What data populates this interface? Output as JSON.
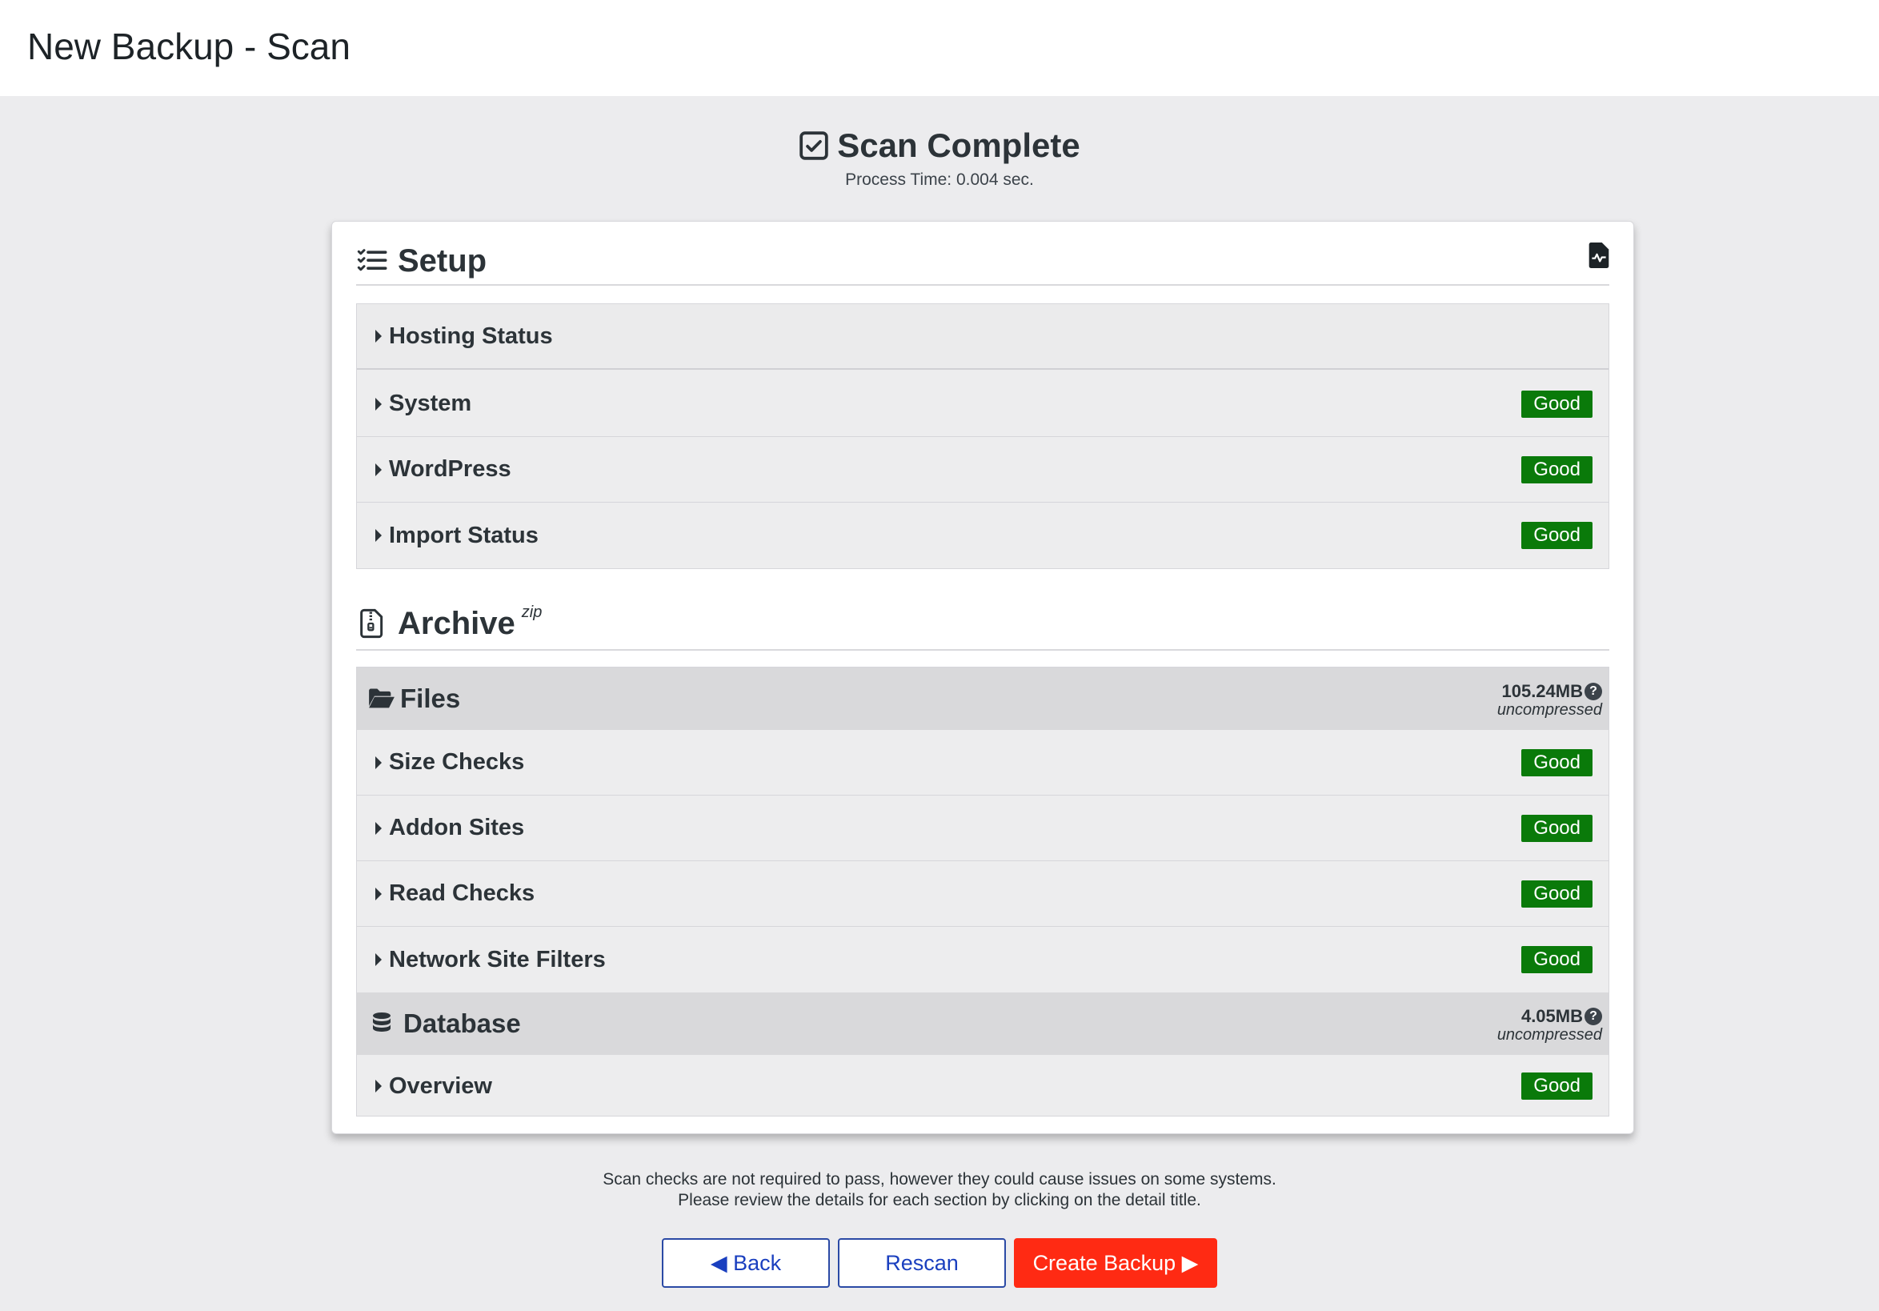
{
  "header": {
    "title": "New Backup - Scan"
  },
  "scan": {
    "title": "Scan Complete",
    "process_time": "Process Time: 0.004 sec."
  },
  "setup": {
    "title": "Setup",
    "rows": [
      {
        "label": "Hosting Status",
        "status": ""
      },
      {
        "label": "System",
        "status": "Good"
      },
      {
        "label": "WordPress",
        "status": "Good"
      },
      {
        "label": "Import Status",
        "status": "Good"
      }
    ]
  },
  "archive": {
    "title": "Archive",
    "format": "zip",
    "files": {
      "title": "Files",
      "size": "105.24MB",
      "size_note": "uncompressed",
      "rows": [
        {
          "label": "Size Checks",
          "status": "Good"
        },
        {
          "label": "Addon Sites",
          "status": "Good"
        },
        {
          "label": "Read Checks",
          "status": "Good"
        },
        {
          "label": "Network Site Filters",
          "status": "Good"
        }
      ]
    },
    "database": {
      "title": "Database",
      "size": "4.05MB",
      "size_note": "uncompressed",
      "rows": [
        {
          "label": "Overview",
          "status": "Good"
        }
      ]
    }
  },
  "footer": {
    "note_line1": "Scan checks are not required to pass, however they could cause issues on some systems.",
    "note_line2": "Please review the details for each section by clicking on the detail title."
  },
  "buttons": {
    "back": "◀ Back",
    "rescan": "Rescan",
    "create": "Create Backup ▶"
  },
  "colors": {
    "good_badge": "#0a7a0a",
    "primary_button": "#ff2a13",
    "secondary_border": "#2b4aa5",
    "page_bg": "#ececee"
  },
  "icons": {
    "scan": "checkbox-checked-icon",
    "setup": "checklist-icon",
    "log": "file-chart-icon",
    "archive": "file-zip-icon",
    "files": "folder-open-icon",
    "database": "database-icon",
    "caret": "caret-right-icon",
    "help": "question-circle-icon"
  }
}
